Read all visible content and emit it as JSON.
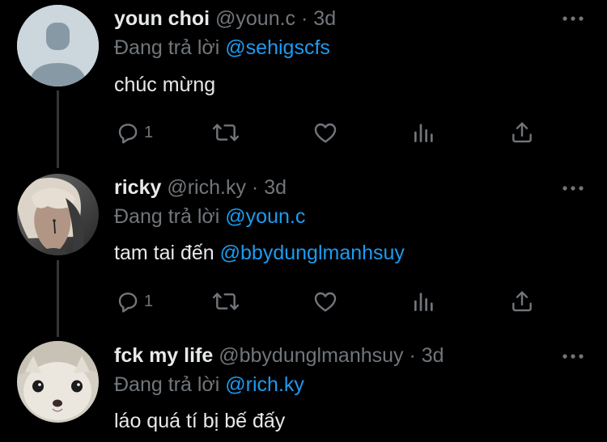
{
  "tweets": [
    {
      "display_name": "youn choi",
      "handle": "@youn.c",
      "separator": "·",
      "time": "3d",
      "replying_prefix": "Đang trả lời",
      "replying_to": "@sehigscfs",
      "text": "chúc mừng",
      "mention": "",
      "reply_count": "1",
      "avatar": "default-avatar-icon"
    },
    {
      "display_name": "ricky",
      "handle": "@rich.ky",
      "separator": "·",
      "time": "3d",
      "replying_prefix": "Đang trả lời",
      "replying_to": "@youn.c",
      "text": "tam tai đến",
      "mention": "@bbydunglmanhsuy",
      "reply_count": "1",
      "avatar": "user-photo"
    },
    {
      "display_name": "fck my life",
      "handle": "@bbydunglmanhsuy",
      "separator": "·",
      "time": "3d",
      "replying_prefix": "Đang trả lời",
      "replying_to": "@rich.ky",
      "text": "láo quá tí bị bế đấy",
      "mention": "",
      "avatar": "cat-photo"
    }
  ],
  "colors": {
    "background": "#000000",
    "text": "#e7e9ea",
    "muted": "#71767b",
    "link": "#1d9bf0"
  }
}
